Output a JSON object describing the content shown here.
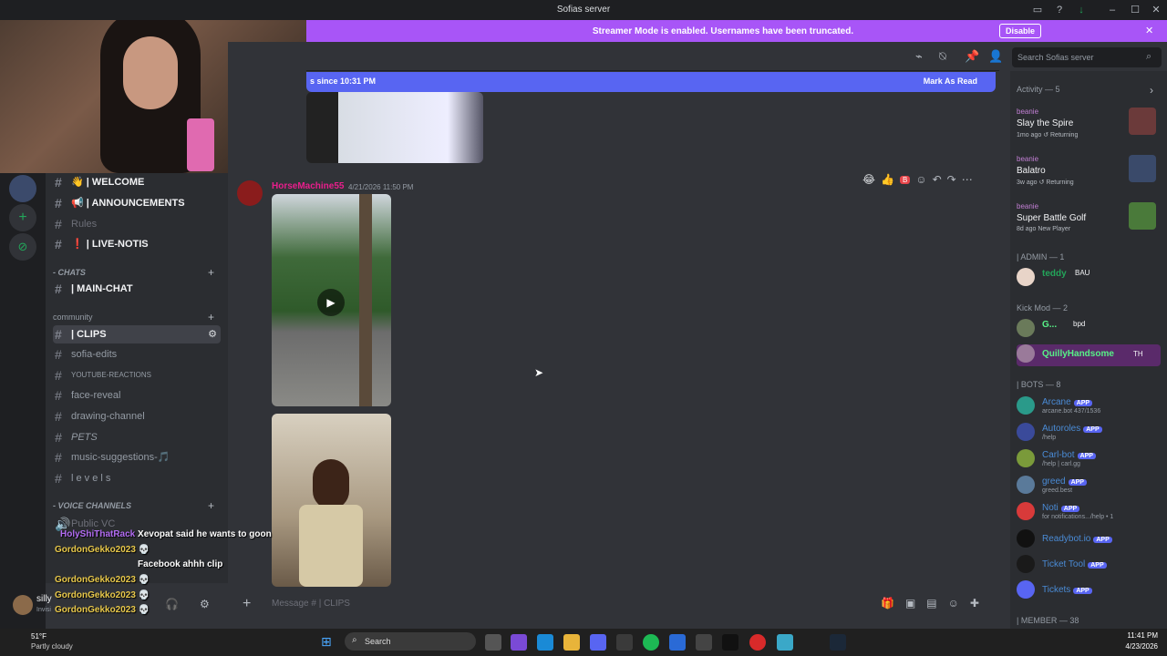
{
  "window": {
    "title": "Sofias server"
  },
  "banner": {
    "text": "Streamer Mode is enabled. Usernames have been truncated.",
    "button": "Disable"
  },
  "new_messages": {
    "text": "s since 10:31 PM",
    "mark_read": "Mark As Read"
  },
  "search": {
    "placeholder": "Search Sofias server"
  },
  "channels": [
    {
      "label": "| WELCOME",
      "emoji": "👋",
      "style": "bold"
    },
    {
      "label": "| ANNOUNCEMENTS",
      "emoji": "📢",
      "style": "bold"
    },
    {
      "label": "Rules",
      "emoji": "",
      "style": "dim"
    },
    {
      "label": "| LIVE-NOTIS",
      "emoji": "❗",
      "style": "bold"
    }
  ],
  "cat_chats": "- CHATS",
  "main_chat": "| MAIN-CHAT",
  "cat_community": "community",
  "community_channels": [
    {
      "label": "| CLIPS",
      "selected": true
    },
    {
      "label": "sofia-edits"
    },
    {
      "label": "YOUTUBE-REACTIONS"
    },
    {
      "label": "face-reveal"
    },
    {
      "label": "drawing-channel"
    },
    {
      "label": "PETS"
    },
    {
      "label": "music-suggestions-🎵"
    },
    {
      "label": "l e v e l s"
    }
  ],
  "cat_voice": "- VOICE CHANNELS",
  "voice": {
    "public": "Public VC"
  },
  "overlay_chat": [
    {
      "user": "HolyShiThatRack",
      "msg": "Xevopat said he wants to goon",
      "color": "#b26cf2"
    },
    {
      "user": "GordonGekko2023",
      "msg": "💀",
      "color": "#e8c84a"
    },
    {
      "user": "GordonGekko2023",
      "msg": "💀",
      "color": "#e8c84a"
    },
    {
      "user": "GordonGekko2023",
      "msg": "💀",
      "color": "#e8c84a"
    },
    {
      "user": "GordonGekko2023",
      "msg": "💀",
      "color": "#e8c84a"
    }
  ],
  "overlay_facebook": "Facebook ahhh clip",
  "user": {
    "name": "silly",
    "status": "Invisi"
  },
  "message": {
    "author": "HorseMachine55",
    "time": "4/21/2026 11:50 PM"
  },
  "composer": {
    "placeholder": "Message #",
    "channel": "| CLIPS"
  },
  "reactions": [
    "😂",
    "👍",
    "B"
  ],
  "activity": {
    "header": "Activity — 5",
    "items": [
      {
        "user": "beanie",
        "game": "Slay the Spire",
        "meta": "1mo ago  ↺ Returning"
      },
      {
        "user": "beanie",
        "game": "Balatro",
        "meta": "3w ago  ↺ Returning"
      },
      {
        "user": "beanie",
        "game": "Super Battle Golf",
        "meta": "8d ago  New Player"
      }
    ]
  },
  "sections": {
    "admin": "| ADMIN — 1",
    "kickmod": "Kick Mod — 2",
    "bots": "| BOTS — 8",
    "member": "| MEMBER — 38"
  },
  "admins": [
    {
      "name": "teddy",
      "tag": "BAU",
      "color": "#23a55a"
    }
  ],
  "mods": [
    {
      "name": "G...",
      "tag": "bpd",
      "color": "#57f287"
    },
    {
      "name": "QuillyHandsome",
      "tag": "TH",
      "color": "#57f287"
    }
  ],
  "bots": [
    {
      "name": "Arcane",
      "sub": "arcane.bot 437/1536"
    },
    {
      "name": "Autoroles",
      "sub": "/help"
    },
    {
      "name": "Carl-bot",
      "sub": "/help | carl.gg"
    },
    {
      "name": "greed",
      "sub": "greed.best"
    },
    {
      "name": "Noti",
      "sub": "for notifications.../help • 1"
    },
    {
      "name": "Readybot.io",
      "sub": ""
    },
    {
      "name": "Ticket Tool",
      "sub": ""
    },
    {
      "name": "Tickets",
      "sub": ""
    }
  ],
  "app_tag": "APP",
  "taskbar": {
    "weather_temp": "51°F",
    "weather_desc": "Partly cloudy",
    "search": "Search",
    "time": "11:41 PM",
    "date": "4/23/2026"
  },
  "colors": {
    "accent": "#5865f2",
    "streamer": "#a855f7",
    "bot_name": "#4a8bd6",
    "online": "#23a55a"
  }
}
